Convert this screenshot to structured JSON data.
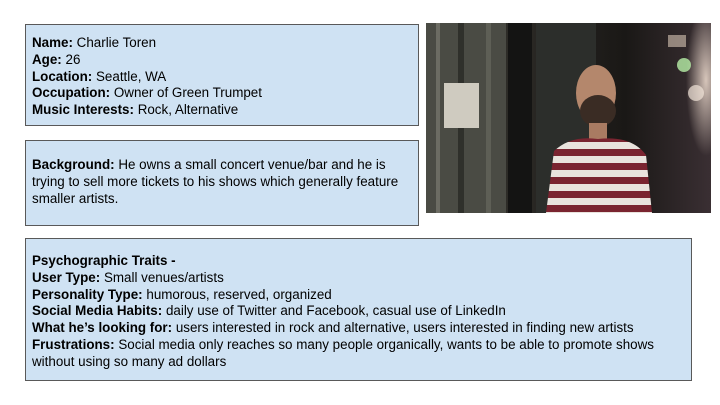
{
  "basic_info": {
    "name_label": "Name:",
    "name_value": "Charlie Toren",
    "age_label": "Age:",
    "age_value": "26",
    "location_label": "Location:",
    "location_value": "Seattle, WA",
    "occupation_label": "Occupation:",
    "occupation_value": "Owner of Green Trumpet",
    "music_label": "Music Interests:",
    "music_value": "Rock, Alternative"
  },
  "background": {
    "label": "Background:",
    "text": "He owns a small concert venue/bar and he is trying to sell more tickets to his shows which generally feature smaller artists."
  },
  "psychographic": {
    "heading": "Psychographic Traits -",
    "user_type_label": "User Type:",
    "user_type_value": "Small venues/artists",
    "personality_label": "Personality Type:",
    "personality_value": "humorous, reserved, organized",
    "social_label": "Social Media Habits:",
    "social_value": "daily use of Twitter and Facebook, casual use of LinkedIn",
    "looking_label": "What he’s looking for:",
    "looking_value": "users interested in rock and alternative, users interested in finding new artists",
    "frustrations_label": "Frustrations:",
    "frustrations_value": "Social media only reaches so many people organically, wants to be able to promote shows without using so many ad dollars"
  },
  "photo": {
    "icon": "persona-photo"
  }
}
